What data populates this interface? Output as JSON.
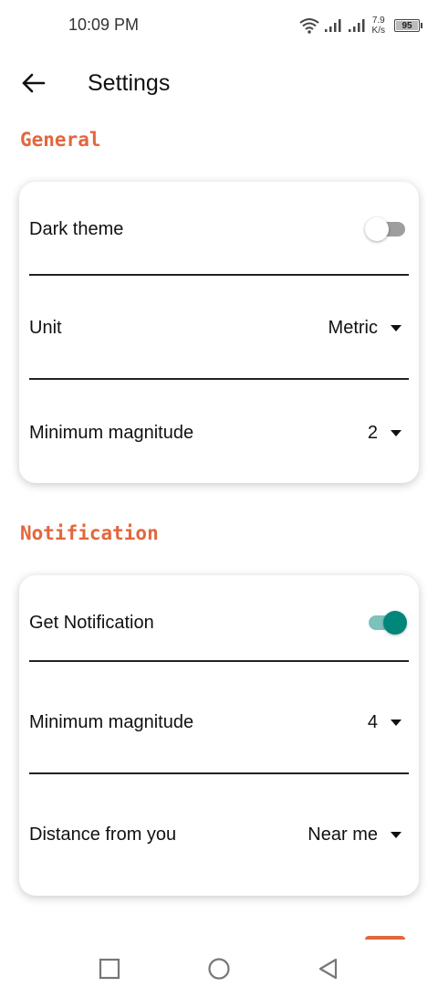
{
  "status_bar": {
    "time": "10:09 PM",
    "net_speed_value": "7.9",
    "net_speed_unit": "K/s",
    "battery_level": "95"
  },
  "app_bar": {
    "title": "Settings",
    "back_icon": "arrow-left-icon"
  },
  "sections": {
    "general": {
      "header": "General",
      "dark_theme": {
        "label": "Dark theme",
        "enabled": false
      },
      "unit": {
        "label": "Unit",
        "value": "Metric"
      },
      "min_magnitude": {
        "label": "Minimum magnitude",
        "value": "2"
      }
    },
    "notification": {
      "header": "Notification",
      "get_notification": {
        "label": "Get Notification",
        "enabled": true
      },
      "min_magnitude": {
        "label": "Minimum magnitude",
        "value": "4"
      },
      "distance": {
        "label": "Distance from you",
        "value": "Near me"
      }
    }
  },
  "colors": {
    "accent": "#e2673d",
    "toggle_on_thumb": "#00877a",
    "toggle_on_track": "#7dc1bd",
    "toggle_off_track": "#9e9e9e"
  },
  "nav_bar": {
    "recents_icon": "square-icon",
    "home_icon": "circle-icon",
    "back_icon": "triangle-back-icon"
  }
}
